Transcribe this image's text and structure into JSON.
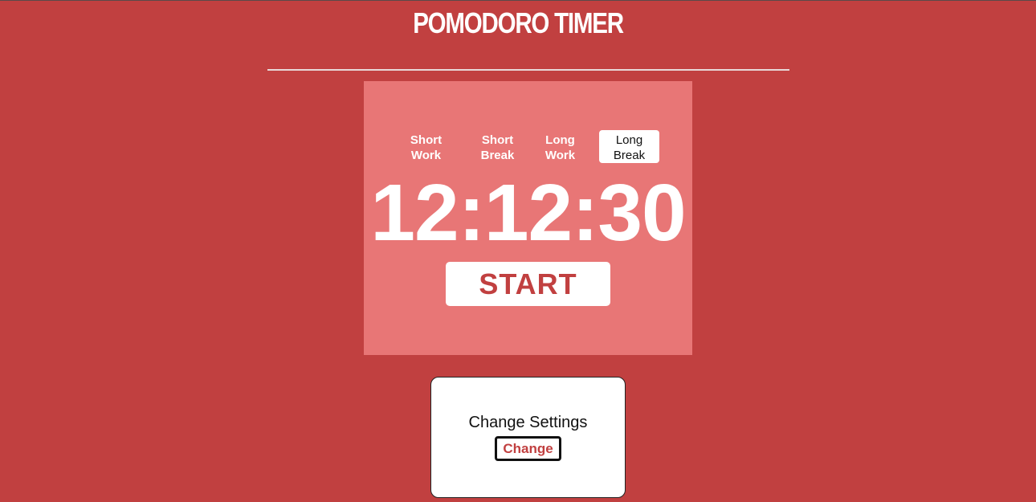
{
  "header": {
    "title": "POMODORO TIMER"
  },
  "timer": {
    "tabs": [
      {
        "label": "Short\nWork",
        "active": false
      },
      {
        "label": "Short\nBreak",
        "active": false
      },
      {
        "label": "Long\nWork",
        "active": false
      },
      {
        "label": "Long\nBreak",
        "active": true
      }
    ],
    "time": "12:12:30",
    "start_label": "START"
  },
  "settings": {
    "title": "Change Settings",
    "change_label": "Change"
  },
  "colors": {
    "background": "#c14040",
    "card": "#e87676",
    "accent": "#c14040",
    "text": "#ffffff"
  }
}
